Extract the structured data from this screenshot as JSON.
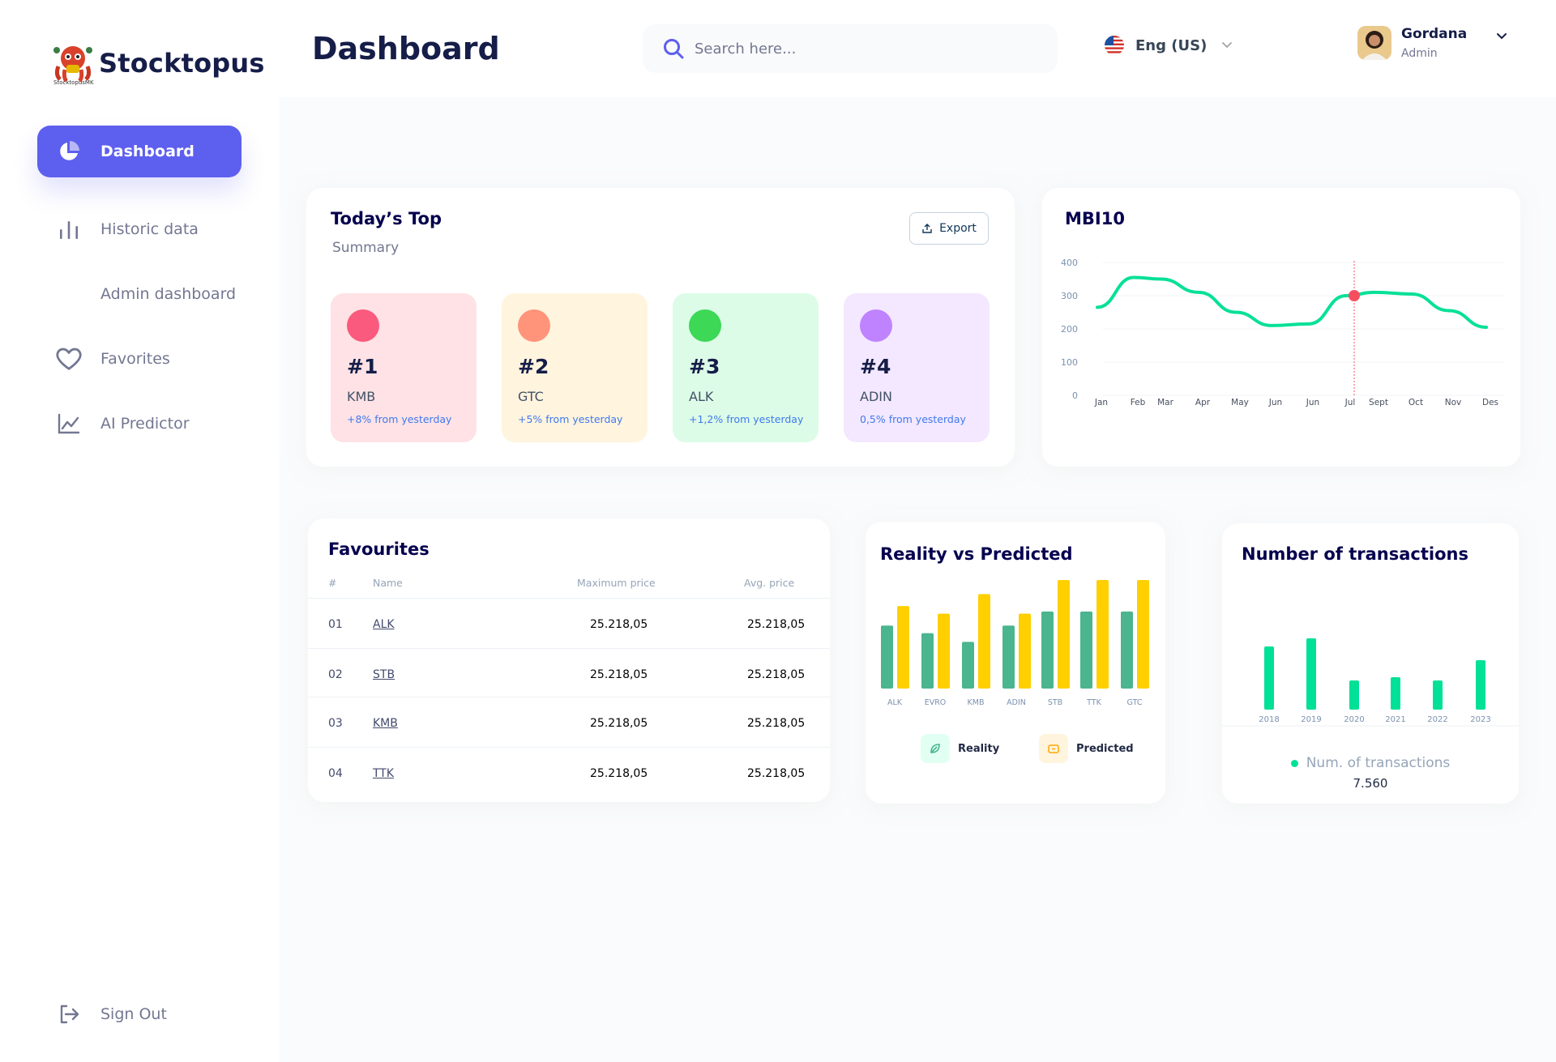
{
  "brand": {
    "name": "Stocktopus",
    "sub": "StocktopusMK"
  },
  "sidebar": {
    "items": [
      {
        "label": "Dashboard",
        "icon": "pie-chart-icon",
        "active": true
      },
      {
        "label": "Historic data",
        "icon": "bar-chart-icon"
      },
      {
        "label": "Admin dashboard",
        "icon": ""
      },
      {
        "label": "Favorites",
        "icon": "heart-icon"
      },
      {
        "label": "AI Predictor",
        "icon": "line-chart-icon"
      }
    ],
    "sign_out": "Sign Out"
  },
  "header": {
    "title": "Dashboard",
    "search_placeholder": "Search here...",
    "language": "Eng (US)",
    "user_name": "Gordana",
    "user_role": "Admin"
  },
  "top": {
    "title": "Today’s Top",
    "subtitle": "Summary",
    "export_label": "Export",
    "cards": [
      {
        "rank": "#1",
        "name": "KMB",
        "delta": "+8% from yesterday",
        "bg": "#ffe2e5",
        "dot": "#fa5a7d"
      },
      {
        "rank": "#2",
        "name": "GTC",
        "delta": "+5% from yesterday",
        "bg": "#fff4de",
        "dot": "#ff947a"
      },
      {
        "rank": "#3",
        "name": "ALK",
        "delta": "+1,2% from yesterday",
        "bg": "#dcfce7",
        "dot": "#3cd856"
      },
      {
        "rank": "#4",
        "name": "ADIN",
        "delta": "0,5% from yesterday",
        "bg": "#f3e8ff",
        "dot": "#bf83ff"
      }
    ]
  },
  "mbi": {
    "title": "MBI10",
    "chart_data": {
      "type": "line",
      "title": "MBI10",
      "x": [
        "Jan",
        "Feb",
        "Mar",
        "Apr",
        "May",
        "Jun",
        "Jun",
        "Jul",
        "Sept",
        "Oct",
        "Nov",
        "Des"
      ],
      "y_ticks": [
        0,
        100,
        200,
        300,
        400
      ],
      "ylim": [
        0,
        400
      ],
      "series": [
        {
          "values": [
            265,
            355,
            350,
            310,
            250,
            210,
            215,
            300,
            310,
            305,
            255,
            205
          ]
        }
      ],
      "highlight": {
        "x": "Jul",
        "y": 300
      },
      "color": "#07e098"
    }
  },
  "favourites": {
    "title": "Favourites",
    "columns": [
      "#",
      "Name",
      "Maximum price",
      "Avg. price"
    ],
    "rows": [
      {
        "num": "01",
        "name": "ALK",
        "max": "25.218,05",
        "avg": "25.218,05"
      },
      {
        "num": "02",
        "name": "STB",
        "max": "25.218,05",
        "avg": "25.218,05"
      },
      {
        "num": "03",
        "name": "KMB",
        "max": "25.218,05",
        "avg": "25.218,05"
      },
      {
        "num": "04",
        "name": "TTK",
        "max": "25.218,05",
        "avg": "25.218,05"
      }
    ]
  },
  "rvp": {
    "title": "Reality vs Predicted",
    "legend_reality": "Reality",
    "legend_predicted": "Predicted",
    "chart_data": {
      "type": "bar",
      "title": "Reality vs Predicted",
      "categories": [
        "ALK",
        "EVRO",
        "KMB",
        "ADIN",
        "STB",
        "TTK",
        "GTC"
      ],
      "series": [
        {
          "name": "Reality",
          "color": "#4ab58e",
          "values": [
            58,
            51,
            43,
            58,
            71,
            71,
            71
          ]
        },
        {
          "name": "Predicted",
          "color": "#ffcf00",
          "values": [
            76,
            69,
            87,
            69,
            100,
            100,
            100
          ]
        }
      ],
      "ylim": [
        0,
        100
      ]
    }
  },
  "transactions": {
    "title": "Number of transactions",
    "legend": "Num. of transactions",
    "value": "7.560",
    "chart_data": {
      "type": "bar",
      "title": "Number of transactions",
      "categories": [
        "2018",
        "2019",
        "2020",
        "2021",
        "2022",
        "2023"
      ],
      "series": [
        {
          "name": "Num. of transactions",
          "color": "#00e096",
          "values": [
            78,
            88,
            36,
            40,
            36,
            61
          ]
        }
      ],
      "ylim": [
        0,
        100
      ]
    }
  }
}
